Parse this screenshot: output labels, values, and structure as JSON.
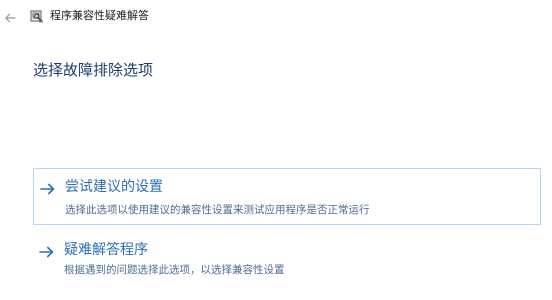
{
  "window": {
    "title": "程序兼容性疑难解答"
  },
  "icons": {
    "back": "back-arrow-icon",
    "app": "compatibility-troubleshooter-icon",
    "option_arrow": "right-arrow-icon"
  },
  "main": {
    "heading": "选择故障排除选项",
    "options": [
      {
        "title": "尝试建议的设置",
        "description": "选择此选项以使用建议的兼容性设置来测试应用程序是否正常运行"
      },
      {
        "title": "疑难解答程序",
        "description": "根据遇到的问题选择此选项，以选择兼容性设置"
      }
    ]
  },
  "colors": {
    "link_blue": "#2b6fb2",
    "heading": "#1f3d6b",
    "description": "#4d6d94",
    "selection_border": "#b9d7f1"
  }
}
